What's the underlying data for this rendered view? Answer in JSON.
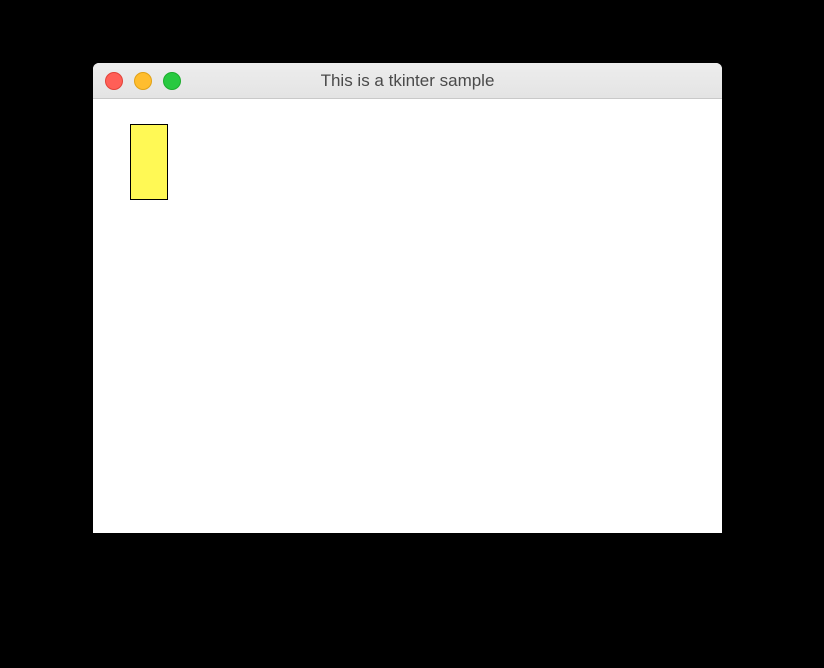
{
  "window": {
    "title": "This is a tkinter sample"
  },
  "canvas": {
    "shapes": [
      {
        "type": "rectangle",
        "fill": "#fff955",
        "outline": "#000000"
      }
    ]
  }
}
